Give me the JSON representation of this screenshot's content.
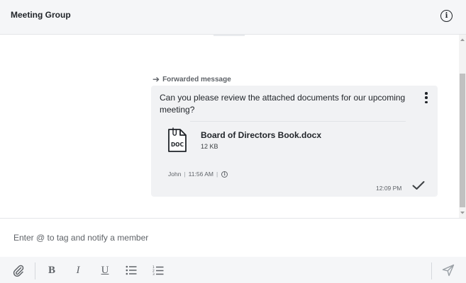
{
  "header": {
    "title": "Meeting Group",
    "info_icon": "info-icon"
  },
  "message": {
    "forwarded_label": "Forwarded message",
    "text": "Can you please review the attached documents for our upcoming meeting?",
    "attachment": {
      "icon_label": "DOC",
      "file_name": "Board of Directors Book.docx",
      "file_size": "12 KB"
    },
    "original_sender": "John",
    "original_time": "11:56 AM",
    "sent_time": "12:09 PM",
    "status_icon": "check-icon"
  },
  "composer": {
    "placeholder": "Enter @ to tag and notify a member"
  },
  "toolbar": {
    "attach_icon": "paperclip-icon",
    "bold": "B",
    "italic": "I",
    "underline": "U",
    "bullet_list_icon": "bullet-list-icon",
    "numbered_list_icon": "numbered-list-icon",
    "send_icon": "send-icon"
  },
  "colors": {
    "header_bg": "#f5f6f8",
    "bubble_bg": "#f1f2f4",
    "text": "#1f2328",
    "muted": "#5f6368",
    "scroll_thumb": "#c1c1c1"
  }
}
